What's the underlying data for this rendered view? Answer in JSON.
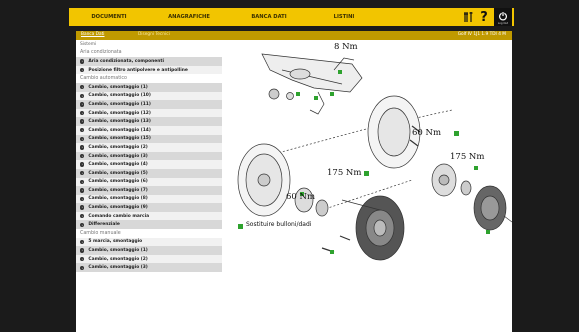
{
  "nav": {
    "items": [
      "DOCUMENTI",
      "ANAGRAFICHE",
      "BANCA DATI",
      "LISTINI"
    ],
    "power_label": "Log Out"
  },
  "header": {
    "breadcrumb_left": "Banca Dati",
    "breadcrumb_mid": "Disegni Tecnici",
    "vehicle": "Golf IV 1J1 1.9 TDI 4 M"
  },
  "sidebar": {
    "system_label": "Sistemi",
    "groups": [
      {
        "title": "Aria condizionata",
        "items": [
          "Aria condizionata, componenti",
          "Posizione filtro antipolvere e antipolline"
        ]
      },
      {
        "title": "Cambio automatico",
        "items": [
          "Cambio, smontaggio (1)",
          "Cambio, smontaggio (10)",
          "Cambio, smontaggio (11)",
          "Cambio, smontaggio (12)",
          "Cambio, smontaggio (13)",
          "Cambio, smontaggio (14)",
          "Cambio, smontaggio (15)",
          "Cambio, smontaggio (2)",
          "Cambio, smontaggio (3)",
          "Cambio, smontaggio (4)",
          "Cambio, smontaggio (5)",
          "Cambio, smontaggio (6)",
          "Cambio, smontaggio (7)",
          "Cambio, smontaggio (8)",
          "Cambio, smontaggio (9)",
          "Comando cambio marcia",
          "Differenziale"
        ]
      },
      {
        "title": "Cambio manuale",
        "items": [
          "5 marcia, smontaggio",
          "Cambio, smontaggio (1)",
          "Cambio, smontaggio (2)",
          "Cambio, smontaggio (3)"
        ]
      }
    ]
  },
  "diagram": {
    "torque_1": "8 Nm",
    "torque_2": "60 Nm",
    "torque_3": "175 Nm",
    "torque_4": "175 Nm",
    "torque_5": "60 Nm",
    "legend": "Sostituire bulloni/dadi",
    "accent_color": "#2ea22e"
  }
}
